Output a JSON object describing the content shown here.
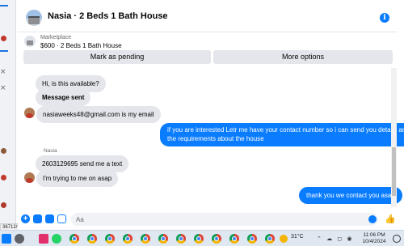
{
  "header": {
    "title": "Nasia · 2 Beds 1 Bath House"
  },
  "marketplace": {
    "label": "Marketplace",
    "listing": "$600 · 2 Beds 1 Bath House"
  },
  "actions": {
    "pending": "Mark as pending",
    "more": "More options"
  },
  "messages": [
    {
      "text": "Hi, is this available?",
      "from": "me"
    },
    {
      "text": "Message sent",
      "from": "me"
    },
    {
      "text": "nasiaweeks48@gmail.com is my email",
      "from": "them"
    },
    {
      "text": "if you are interested Letr me have your contact number so i can send you details and the requirements about the house",
      "from": "me"
    },
    {
      "sender": "Nasia",
      "text": "2603129695 send me a text",
      "from": "them"
    },
    {
      "text": "I'm trying to me on asap",
      "from": "them"
    },
    {
      "text": "thank you we contact you asap",
      "from": "me"
    }
  ],
  "out_lines": [
    "if you are interested Letr me have your contact number so i can send you details and",
    "the requirements about the house"
  ],
  "composer": {
    "placeholder": "Aa"
  },
  "status_url": "36712/?referralSurface...",
  "taskbar": {
    "weather": "31°C",
    "time": "11:06 PM",
    "date": "10/4/2024"
  },
  "colors": {
    "accent": "#0a7cff",
    "bubble_in": "#e4e6eb"
  },
  "icons": [
    "info-icon",
    "plus-icon",
    "photo-icon",
    "sticker-icon",
    "gif-icon",
    "emoji-icon",
    "like-icon",
    "chrome-icon",
    "windows-icon"
  ]
}
